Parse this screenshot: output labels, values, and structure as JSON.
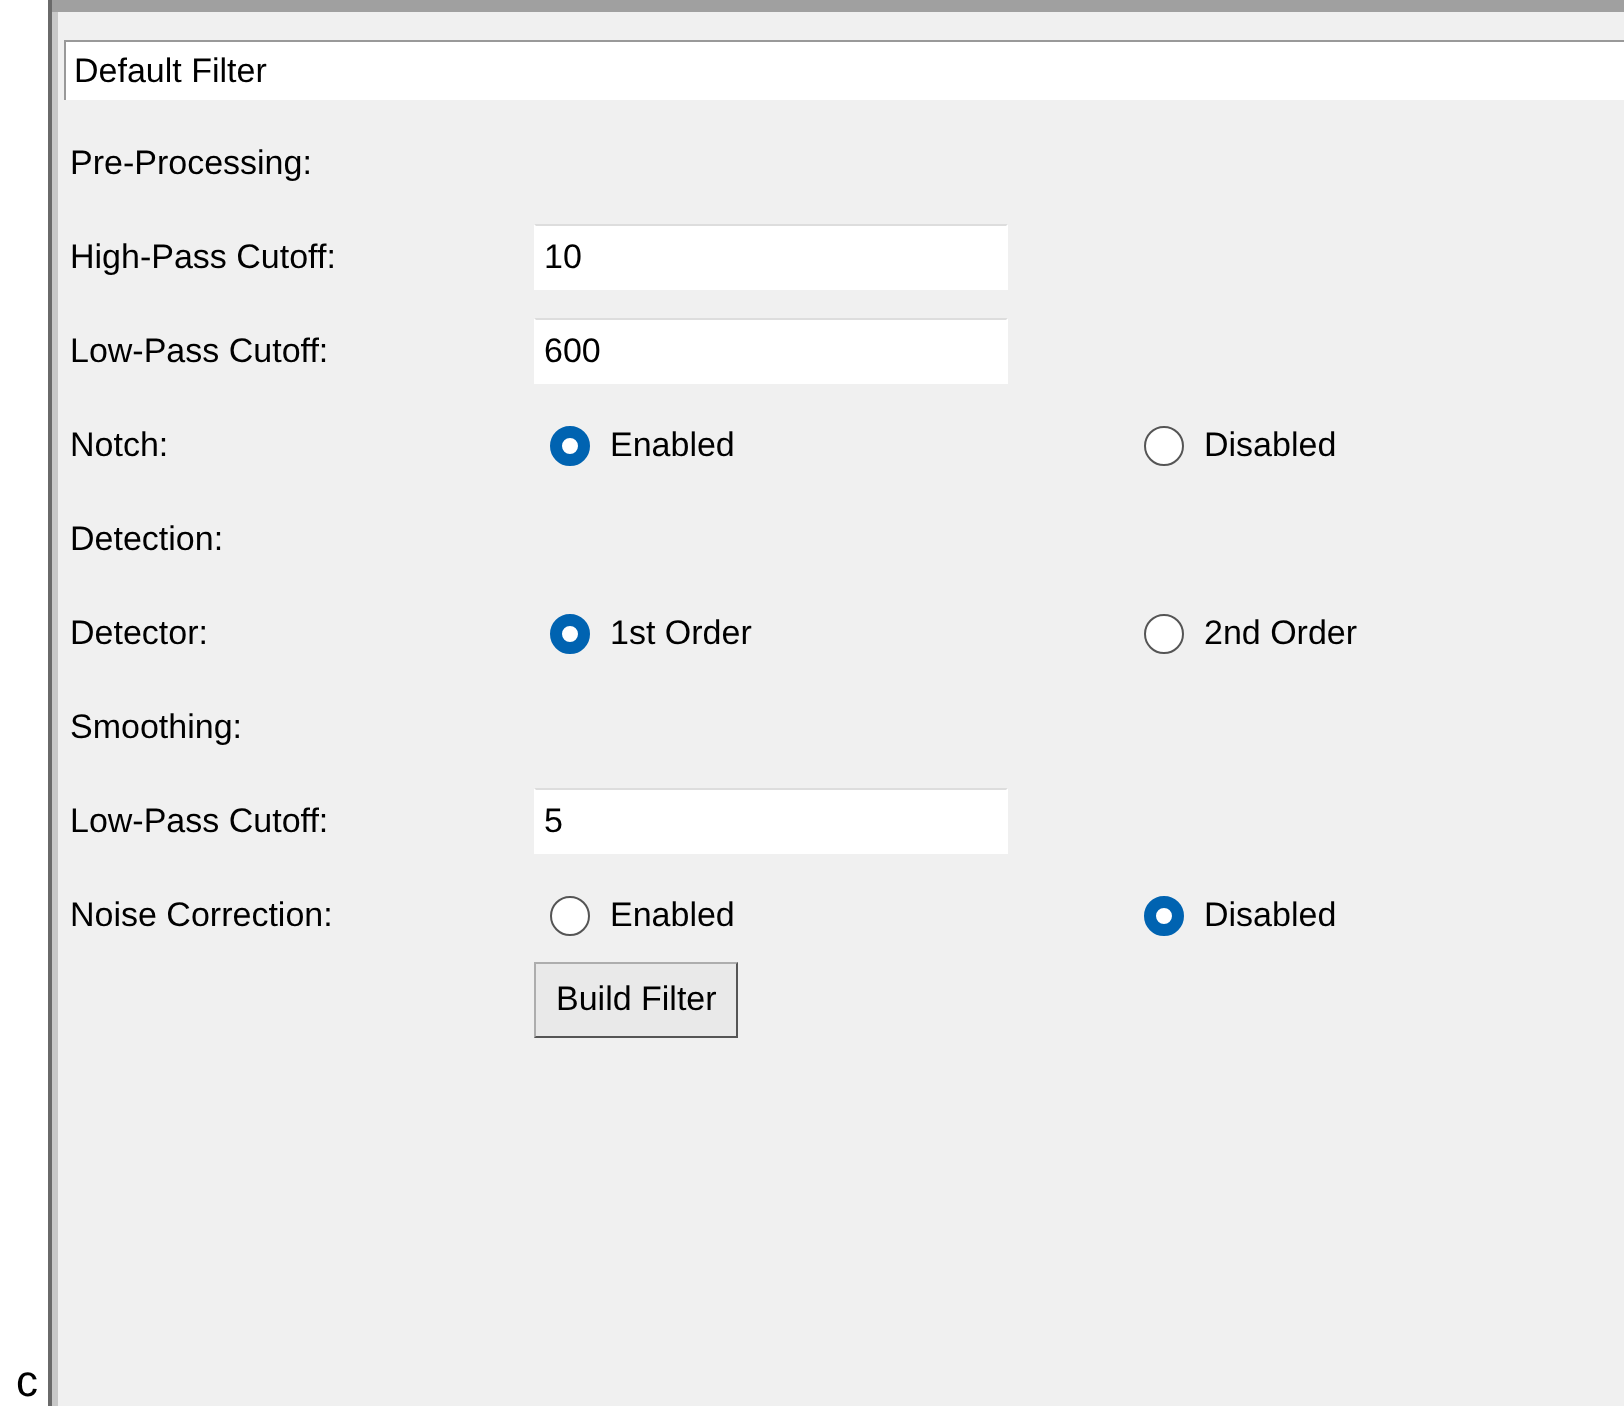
{
  "name_field": {
    "value": "Default Filter"
  },
  "rows": [
    {
      "kind": "section",
      "label": "Pre-Processing:"
    },
    {
      "kind": "entry",
      "label": "High-Pass Cutoff:",
      "value": "10"
    },
    {
      "kind": "entry",
      "label": "Low-Pass Cutoff:",
      "value": "600"
    },
    {
      "kind": "radio",
      "label": "Notch:",
      "options": [
        {
          "label": "Enabled",
          "selected": true
        },
        {
          "label": "Disabled",
          "selected": false
        }
      ]
    },
    {
      "kind": "section",
      "label": "Detection:"
    },
    {
      "kind": "radio",
      "label": "Detector:",
      "options": [
        {
          "label": "1st Order",
          "selected": true
        },
        {
          "label": "2nd Order",
          "selected": false
        }
      ]
    },
    {
      "kind": "section",
      "label": "Smoothing:"
    },
    {
      "kind": "entry",
      "label": "Low-Pass Cutoff:",
      "value": "5"
    },
    {
      "kind": "radio",
      "label": "Noise Correction:",
      "options": [
        {
          "label": "Enabled",
          "selected": false
        },
        {
          "label": "Disabled",
          "selected": true
        }
      ]
    }
  ],
  "button": "Build Filter",
  "corner_text": "c"
}
